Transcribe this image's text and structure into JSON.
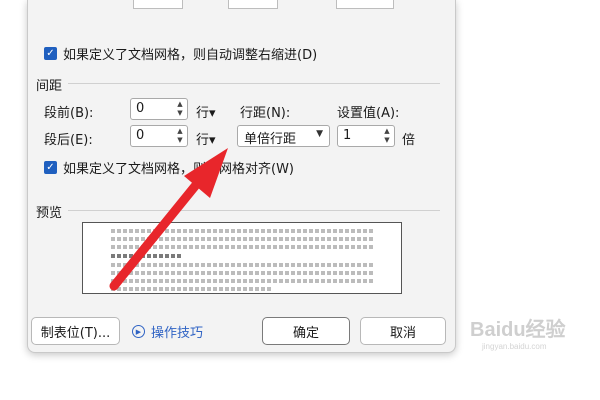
{
  "dialog": {
    "checkbox_right_indent": {
      "label": "如果定义了文档网格，则自动调整右缩进(D)",
      "checked": true
    },
    "spacing_section_label": "间距",
    "before": {
      "label": "段前(B):",
      "value": "0",
      "unit": "行▾"
    },
    "after": {
      "label": "段后(E):",
      "value": "0",
      "unit": "行▾"
    },
    "line_spacing": {
      "label": "行距(N):",
      "value": "单倍行距"
    },
    "setting_value": {
      "label": "设置值(A):",
      "value": "1",
      "unit": "倍"
    },
    "checkbox_grid": {
      "label": "如果定义了文档网格，则与网格对齐(W)",
      "checked": true
    },
    "preview_label": "预览",
    "buttons": {
      "tabs": "制表位(T)...",
      "tips": "操作技巧",
      "ok": "确定",
      "cancel": "取消"
    }
  },
  "annotation": {
    "color": "#e8262b"
  },
  "watermark": {
    "text": "Baidu经验",
    "url": "jingyan.baidu.com"
  }
}
